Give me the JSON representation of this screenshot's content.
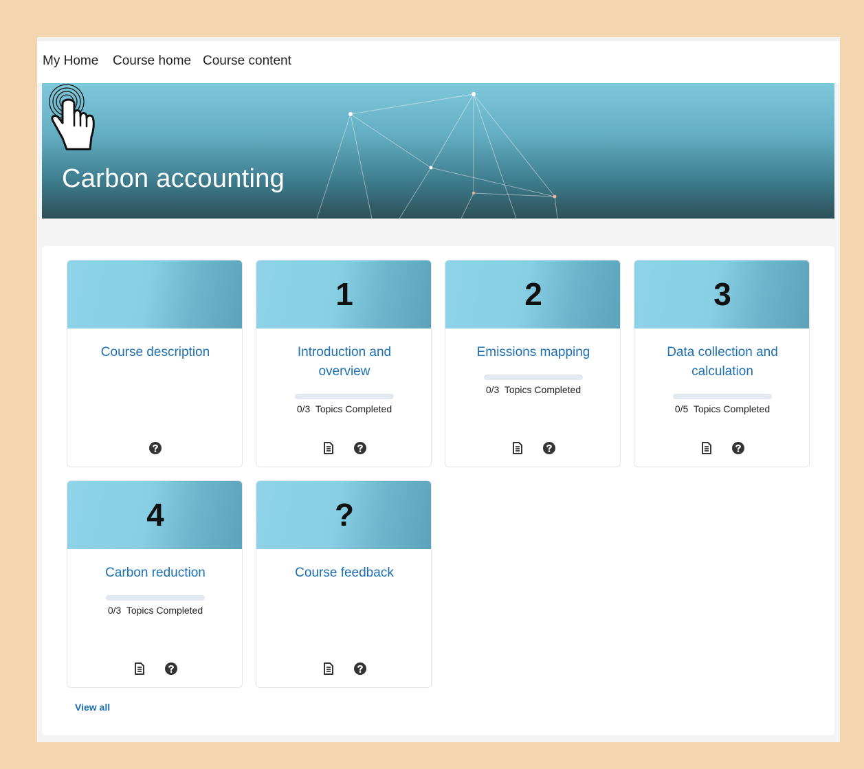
{
  "nav": {
    "my_home": "My Home",
    "course_home": "Course home",
    "course_content": "Course content"
  },
  "banner": {
    "title": "Carbon accounting"
  },
  "cards": [
    {
      "number": "",
      "title_line1": "Course description",
      "title_line2": "",
      "progress_text": "",
      "progress_fraction": null,
      "icons": [
        "help-icon"
      ]
    },
    {
      "number": "1",
      "title_line1": "Introduction and",
      "title_line2": "overview",
      "progress_text": "0/3  Topics Completed",
      "progress_fraction": 0,
      "icons": [
        "document-icon",
        "help-icon"
      ]
    },
    {
      "number": "2",
      "title_line1": "Emissions mapping",
      "title_line2": "",
      "progress_text": "0/3  Topics Completed",
      "progress_fraction": 0,
      "icons": [
        "document-icon",
        "help-icon"
      ]
    },
    {
      "number": "3",
      "title_line1": "Data collection and",
      "title_line2": "calculation",
      "progress_text": "0/5  Topics Completed",
      "progress_fraction": 0,
      "icons": [
        "document-icon",
        "help-icon"
      ]
    },
    {
      "number": "4",
      "title_line1": "Carbon reduction",
      "title_line2": "",
      "progress_text": "0/3  Topics Completed",
      "progress_fraction": 0,
      "icons": [
        "document-icon",
        "help-icon"
      ]
    },
    {
      "number": "?",
      "title_line1": "Course feedback",
      "title_line2": "",
      "progress_text": "",
      "progress_fraction": null,
      "icons": [
        "document-icon",
        "help-icon"
      ]
    }
  ],
  "view_all": "View all",
  "colors": {
    "link": "#1c6fb3",
    "page_bg": "#f3d5b0",
    "banner_top": "#7fc8dc",
    "banner_bottom": "#2d4f58"
  }
}
